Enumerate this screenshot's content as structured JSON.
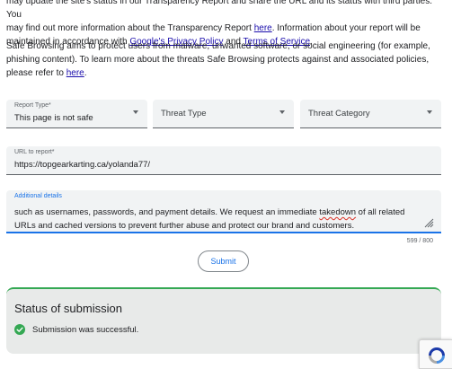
{
  "intro": {
    "line1": "may update the site's status in our Transparency Report and share the URL and its status with third parties. You",
    "line2_pre": "may find out more information about the Transparency Report ",
    "line2_link": "here",
    "line2_post": ". Information about your report will be",
    "line3_pre": "maintained in accordance with ",
    "privacy_link": "Google's Privacy Policy",
    "and": " and ",
    "terms_link": "Terms of Service",
    "line3_post": "."
  },
  "safe_browsing": {
    "text": "Safe Browsing aims to protect users from malware, unwanted software, or social engineering (for example, phishing content). To learn more about the threats Safe Browsing protects against and associated policies, please refer to ",
    "link": "here",
    "end": "."
  },
  "report_type": {
    "label": "Report Type*",
    "value": "This page is not safe"
  },
  "threat_type": {
    "placeholder": "Threat Type"
  },
  "threat_category": {
    "placeholder": "Threat Category"
  },
  "url_field": {
    "label": "URL to report*",
    "value": "https://topgearkarting.ca/yolanda77/"
  },
  "details": {
    "label": "Additional details",
    "text_before": "such as usernames, passwords, and payment details. We request an immediate ",
    "misspelled": "takedown",
    "text_after": " of all related URLs and cached versions to prevent further abuse and protect our brand and customers.",
    "counter": "599 / 800"
  },
  "submit": {
    "label": "Submit"
  },
  "status": {
    "title": "Status of submission",
    "message": "Submission was successful."
  },
  "icons": {
    "dropdown": "caret-down-icon",
    "resize": "resize-handle-icon",
    "check": "check-circle-icon",
    "captcha": "recaptcha-icon"
  },
  "colors": {
    "link": "#1a0dab",
    "accent": "#1a73e8",
    "success": "#34a853",
    "field_bg": "#f1f3f4",
    "status_bg": "#e8eae9",
    "spell_error": "#d93025"
  }
}
